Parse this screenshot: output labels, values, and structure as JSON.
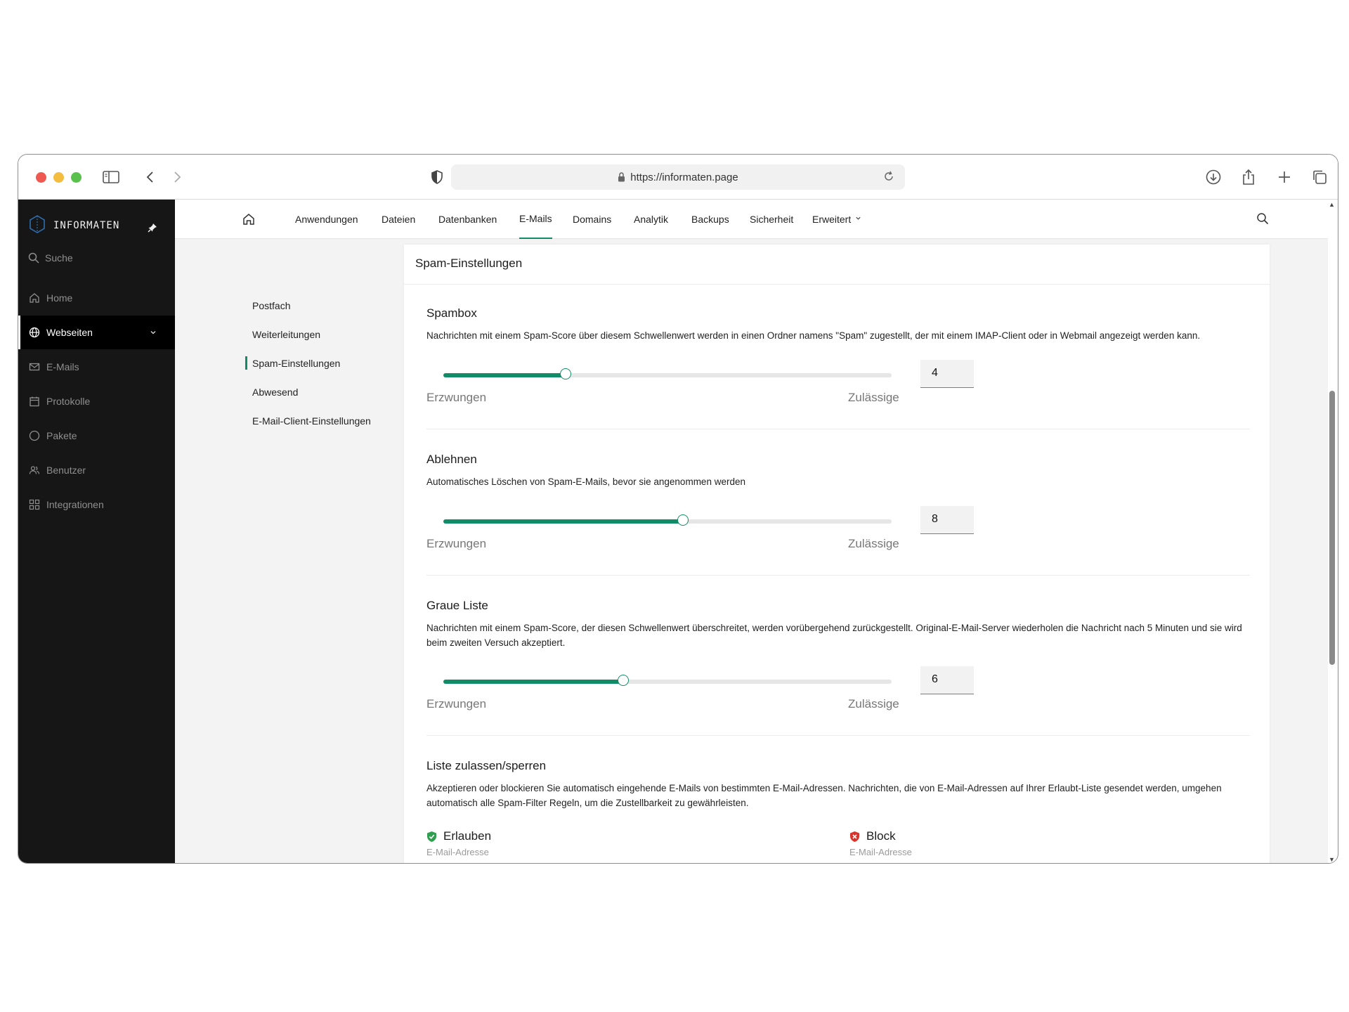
{
  "browser": {
    "url": "https://informaten.page"
  },
  "sidebar": {
    "brand": "INFORMATEN",
    "search_label": "Suche",
    "items": [
      {
        "label": "Home",
        "icon": "home-icon"
      },
      {
        "label": "Webseiten",
        "icon": "globe-icon",
        "active": true
      },
      {
        "label": "E-Mails",
        "icon": "mail-icon"
      },
      {
        "label": "Protokolle",
        "icon": "calendar-icon"
      },
      {
        "label": "Pakete",
        "icon": "circle-icon"
      },
      {
        "label": "Benutzer",
        "icon": "users-icon"
      },
      {
        "label": "Integrationen",
        "icon": "grid-icon"
      }
    ]
  },
  "topnav": {
    "tabs": [
      {
        "label": "Anwendungen"
      },
      {
        "label": "Dateien"
      },
      {
        "label": "Datenbanken"
      },
      {
        "label": "E-Mails",
        "active": true
      },
      {
        "label": "Domains"
      },
      {
        "label": "Analytik"
      },
      {
        "label": "Backups"
      },
      {
        "label": "Sicherheit"
      },
      {
        "label": "Erweitert"
      }
    ]
  },
  "subnav": {
    "items": [
      {
        "label": "Postfach"
      },
      {
        "label": "Weiterleitungen"
      },
      {
        "label": "Spam-Einstellungen",
        "active": true
      },
      {
        "label": "Abwesend"
      },
      {
        "label": "E-Mail-Client-Einstellungen"
      }
    ]
  },
  "card": {
    "title": "Spam-Einstellungen",
    "sections": [
      {
        "title": "Spambox",
        "description": "Nachrichten mit einem Spam-Score über diesem Schwellenwert werden in einen Ordner namens \"Spam\" zugestellt, der mit einem IMAP-Client oder in Webmail angezeigt werden kann.",
        "value": "4",
        "slider_fraction": 0.273,
        "label_left": "Erzwungen",
        "label_right": "Zulässige"
      },
      {
        "title": "Ablehnen",
        "description": "Automatisches Löschen von Spam-E-Mails, bevor sie angenommen werden",
        "value": "8",
        "slider_fraction": 0.534,
        "label_left": "Erzwungen",
        "label_right": "Zulässige"
      },
      {
        "title": "Graue Liste",
        "description": "Nachrichten mit einem Spam-Score, der diesen Schwellenwert überschreitet, werden vorübergehend zurückgestellt. Original-E-Mail-Server wiederholen die Nachricht nach 5 Minuten und sie wird beim zweiten Versuch akzeptiert.",
        "value": "6",
        "slider_fraction": 0.402,
        "label_left": "Erzwungen",
        "label_right": "Zulässige"
      }
    ],
    "list": {
      "title": "Liste zulassen/sperren",
      "description": "Akzeptieren oder blockieren Sie automatisch eingehende E-Mails von bestimmten E-Mail-Adressen. Nachrichten, die von E-Mail-Adressen auf Ihrer Erlaubt-Liste gesendet werden, umgehen automatisch alle Spam-Filter Regeln, um die Zustellbarkeit zu gewährleisten.",
      "allow_label": "Erlauben",
      "allow_sub": "E-Mail-Adresse",
      "block_label": "Block",
      "block_sub": "E-Mail-Adresse"
    }
  },
  "colors": {
    "accent": "#118c66",
    "sidebar_bg": "#161616",
    "allow": "#2e9e4f",
    "block": "#d9342b"
  }
}
